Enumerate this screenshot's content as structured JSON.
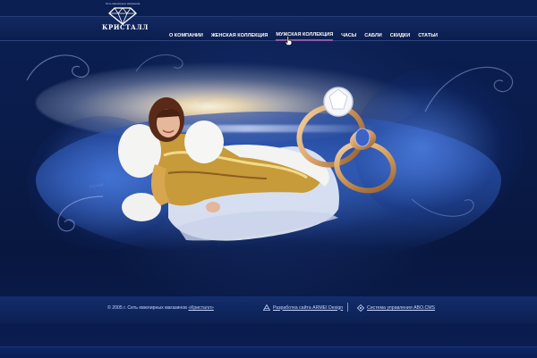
{
  "logo": {
    "name": "КРИСТАЛЛ",
    "tagline": "Сеть ювелирных магазинов",
    "icon": "diamond-icon"
  },
  "nav": {
    "items": [
      {
        "label": "О КОМПАНИИ",
        "active": false
      },
      {
        "label": "ЖЕНСКАЯ КОЛЛЕКЦИЯ",
        "active": false
      },
      {
        "label": "МУЖСКАЯ КОЛЛЕКЦИЯ",
        "active": true
      },
      {
        "label": "ЧАСЫ",
        "active": false
      },
      {
        "label": "САБЛИ",
        "active": false
      },
      {
        "label": "СКИДКИ",
        "active": false
      },
      {
        "label": "СТАТЬИ",
        "active": false
      }
    ],
    "active_underline_color": "#8b5aa8"
  },
  "footer": {
    "copyright": "© 2005 г.  Сеть ювелирных магазинов",
    "store_link": "«Кристалл»",
    "credit_design": "Разработка сайта ARMEI Design",
    "credit_cms": "Система управления ABO.CMS"
  },
  "colors": {
    "background": "#0a1a44",
    "text_light": "#c9d5ff",
    "nav_text": "#ffffff"
  }
}
